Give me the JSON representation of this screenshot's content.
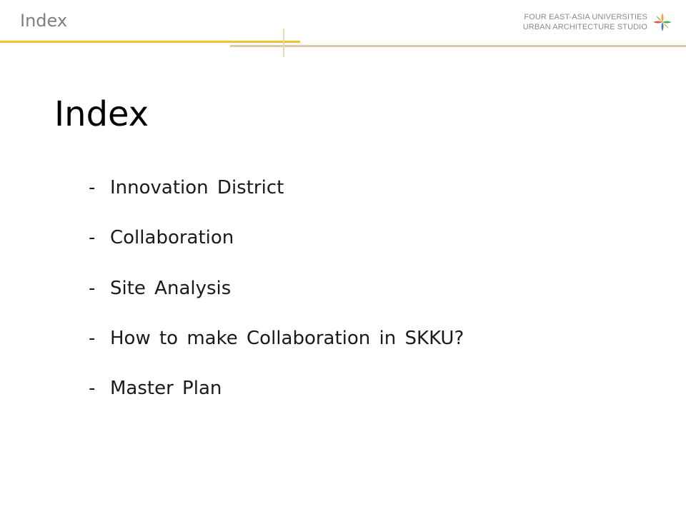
{
  "header": {
    "section_title": "Index",
    "brand_line1": "FOUR EAST-ASIA  UNIVERSITIES",
    "brand_line2": "URBAN ARCHITECTURE STUDIO",
    "logo_icon": "four-color-star-logo-icon",
    "accent_gold": "#f2c12e",
    "accent_tan": "#d8c9a3"
  },
  "main": {
    "title": "Index",
    "bullet": "-",
    "items": [
      "Innovation District",
      "Collaboration",
      "Site Analysis",
      "How to make Collaboration  in SKKU?",
      "Master Plan"
    ]
  }
}
